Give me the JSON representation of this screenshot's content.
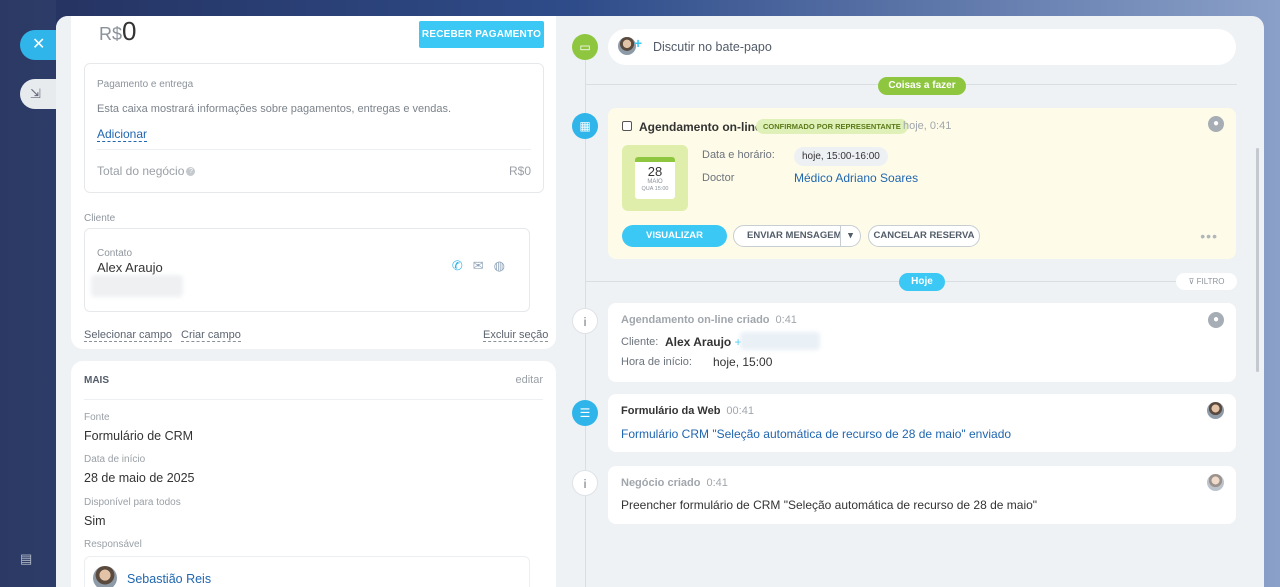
{
  "left": {
    "price_currency": "R$",
    "price_value": "0",
    "receive_button": "RECEBER PAGAMENTO",
    "payment": {
      "title": "Pagamento e entrega",
      "description": "Esta caixa mostrará informações sobre pagamentos, entregas e vendas.",
      "add_link": "Adicionar",
      "total_label": "Total do negócio",
      "total_value": "R$0"
    },
    "client": {
      "section_label": "Cliente",
      "contact_label": "Contato",
      "contact_name": "Alex Araujo"
    },
    "section_links": {
      "select_field": "Selecionar campo",
      "create_field": "Criar campo",
      "delete_section": "Excluir seção"
    },
    "mais": {
      "title": "MAIS",
      "edit": "editar",
      "fields": [
        {
          "label": "Fonte",
          "value": "Formulário de CRM"
        },
        {
          "label": "Data de início",
          "value": "28 de maio de 2025"
        },
        {
          "label": "Disponível para todos",
          "value": "Sim"
        }
      ],
      "responsible_label": "Responsável",
      "responsible_name": "Sebastião Reis"
    }
  },
  "timeline": {
    "chat_placeholder": "Discutir no bate-papo",
    "todo_pill": "Coisas a fazer",
    "today_pill": "Hoje",
    "filter": "FILTRO",
    "booking": {
      "title": "Agendamento on-line",
      "badge": "CONFIRMADO POR REPRESENTANTE",
      "time": "hoje, 0:41",
      "calendar_day": "28",
      "calendar_month": "MAIO",
      "calendar_sub": "QUA 15:00",
      "datetime_label": "Data e horário:",
      "datetime_value": "hoje, 15:00-16:00",
      "doctor_label": "Doctor",
      "doctor_value": "Médico Adriano Soares",
      "view_button": "VISUALIZAR",
      "send_button": "ENVIAR MENSAGEM",
      "cancel_button": "CANCELAR RESERVA"
    },
    "events": [
      {
        "title": "Agendamento on-line criado",
        "time": "0:41",
        "client_label": "Cliente:",
        "client_name": "Alex Araujo",
        "start_label": "Hora de início:",
        "start_value": "hoje, 15:00"
      },
      {
        "title": "Formulário da Web",
        "time": "00:41",
        "link": "Formulário CRM \"Seleção automática de recurso de 28 de maio\" enviado"
      },
      {
        "title": "Negócio criado",
        "time": "0:41",
        "text": "Preencher formulário de CRM \"Seleção automática de recurso de 28 de maio\""
      }
    ]
  },
  "colors": {
    "accent": "#3bc8f5",
    "green": "#8ec63f",
    "link": "#2066b0",
    "background": "#eef2f4"
  }
}
